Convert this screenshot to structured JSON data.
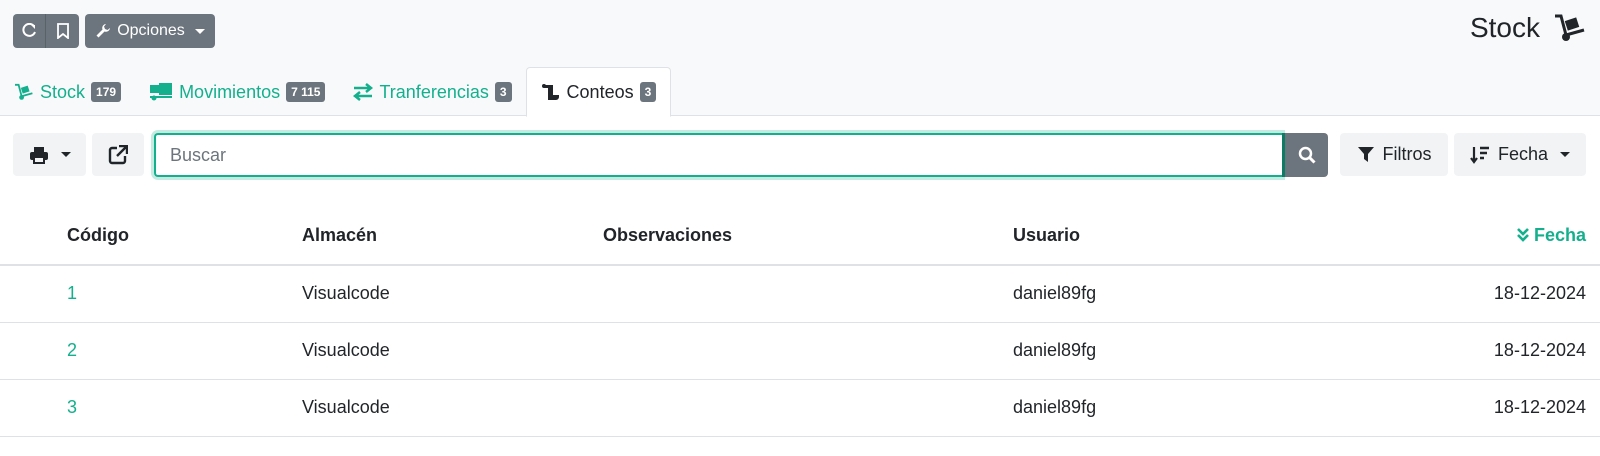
{
  "header": {
    "opciones_label": "Opciones",
    "page_title": "Stock"
  },
  "tabs": [
    {
      "label": "Stock",
      "count": "179",
      "icon": "dolly-icon"
    },
    {
      "label": "Movimientos",
      "count": "7 115",
      "icon": "truck-loading-icon"
    },
    {
      "label": "Tranferencias",
      "count": "3",
      "icon": "exchange-icon"
    },
    {
      "label": "Conteos",
      "count": "3",
      "icon": "scroll-icon",
      "active": true
    }
  ],
  "toolbar": {
    "search_placeholder": "Buscar",
    "filters_label": "Filtros",
    "sort_label": "Fecha"
  },
  "table": {
    "columns": [
      "Código",
      "Almacén",
      "Observaciones",
      "Usuario",
      "Fecha"
    ],
    "rows": [
      [
        "1",
        "Visualcode",
        "",
        "daniel89fg",
        "18-12-2024"
      ],
      [
        "2",
        "Visualcode",
        "",
        "daniel89fg",
        "18-12-2024"
      ],
      [
        "3",
        "Visualcode",
        "",
        "daniel89fg",
        "18-12-2024"
      ]
    ]
  },
  "colors": {
    "accent": "#14b08d",
    "button_dark": "#6c757d",
    "topbar_bg": "#f8f9fa"
  }
}
